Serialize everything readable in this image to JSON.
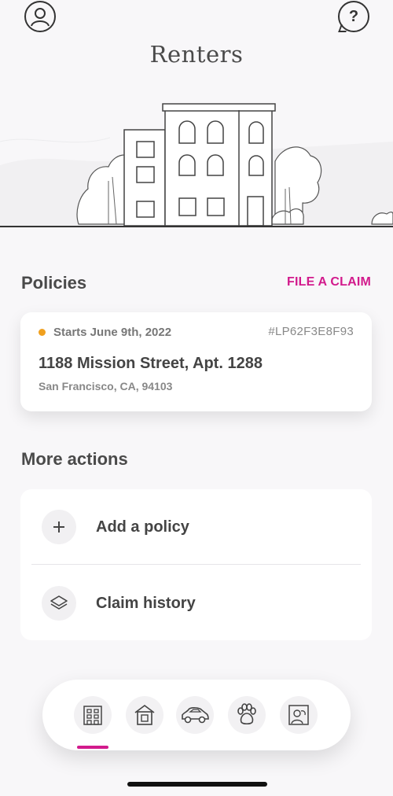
{
  "header": {
    "title": "Renters",
    "help_label": "?"
  },
  "policies": {
    "section_title": "Policies",
    "file_claim_label": "FILE A CLAIM",
    "card": {
      "status": "Starts June 9th, 2022",
      "status_color": "#f0a01e",
      "policy_id": "#LP62F3E8F93",
      "address_line1": "1188 Mission Street, Apt. 1288",
      "address_line2": "San Francisco, CA, 94103"
    }
  },
  "more_actions": {
    "section_title": "More actions",
    "items": [
      {
        "label": "Add a policy",
        "icon": "plus-icon"
      },
      {
        "label": "Claim history",
        "icon": "layers-icon"
      }
    ]
  },
  "bottom_nav": {
    "items": [
      {
        "icon": "apartment-icon",
        "active": true
      },
      {
        "icon": "house-icon",
        "active": false
      },
      {
        "icon": "car-icon",
        "active": false
      },
      {
        "icon": "paw-icon",
        "active": false
      },
      {
        "icon": "photo-icon",
        "active": false
      }
    ],
    "accent_color": "#d21a8c"
  }
}
